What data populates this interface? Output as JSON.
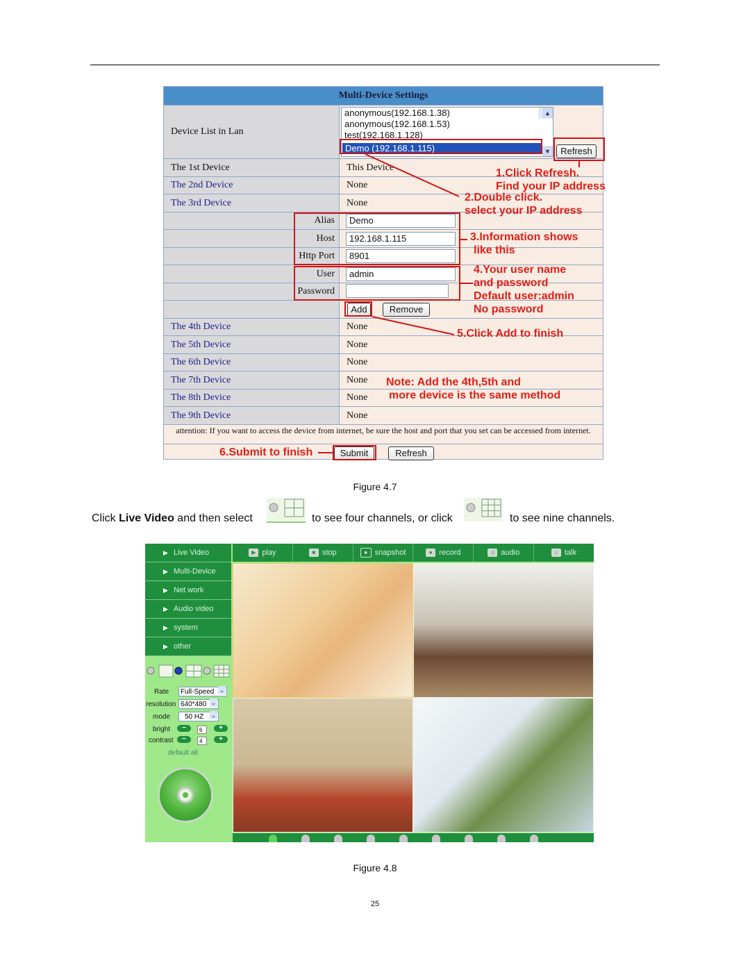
{
  "figure47": {
    "title": "Multi-Device Settings",
    "device_list_label": "Device List in Lan",
    "device_list": [
      "anonymous(192.168.1.38)",
      "anonymous(192.168.1.53)",
      "test(192.168.1.128)",
      "Demo (192.168.1.115)"
    ],
    "refresh_top": "Refresh",
    "rows": [
      {
        "label": "The 1st Device",
        "value": "This Device"
      },
      {
        "label": "The 2nd Device",
        "value": "None"
      },
      {
        "label": "The 3rd Device",
        "value": "None"
      }
    ],
    "form": {
      "alias_label": "Alias",
      "alias_value": "Demo",
      "host_label": "Host",
      "host_value": "192.168.1.115",
      "port_label": "Http Port",
      "port_value": "8901",
      "user_label": "User",
      "user_value": "admin",
      "password_label": "Password",
      "password_value": "",
      "add": "Add",
      "remove": "Remove"
    },
    "rows2": [
      {
        "label": "The 4th Device",
        "value": "None"
      },
      {
        "label": "The 5th Device",
        "value": "None"
      },
      {
        "label": "The 6th Device",
        "value": "None"
      },
      {
        "label": "The 7th Device",
        "value": "None"
      },
      {
        "label": "The 8th Device",
        "value": "None"
      },
      {
        "label": "The 9th Device",
        "value": "None"
      }
    ],
    "attention": "attention: If you want to access the device from internet, be sure the host and port that you set can be accessed from internet.",
    "submit": "Submit",
    "refresh_bottom": "Refresh",
    "annotations": {
      "a1_l1": "1.Click Refresh.",
      "a1_l2": "Find your IP address",
      "a2_l1": "2.Double click.",
      "a2_l2": "select your IP address",
      "a3_l1": "3.Information shows",
      "a3_l2": "like this",
      "a4_l1": "4.Your user name",
      "a4_l2": "and password",
      "a4_l3": "Default user:admin",
      "a4_l4": "No password",
      "a5": "5.Click Add to finish",
      "note_l1": "Note: Add the 4th,5th and",
      "note_l2": "more device is the same method",
      "a6": "6.Submit to finish"
    }
  },
  "caption47": "Figure 4.7",
  "instruction": {
    "p1": "Click ",
    "bold": "Live Video",
    "p2": " and then select",
    "p3": "to see four channels, or click",
    "p4": "to see nine channels."
  },
  "figure48": {
    "sidebar": [
      "Live Video",
      "Multi-Device",
      "Net work",
      "Audio video",
      "system",
      "other"
    ],
    "toolbar": [
      "play",
      "stop",
      "snapshot",
      "record",
      "audio",
      "talk"
    ],
    "controls": {
      "rate_label": "Rate",
      "rate_value": "Full-Speed",
      "resolution_label": "resolution",
      "resolution_value": "640*480",
      "mode_label": "mode",
      "mode_value": "50 HZ",
      "bright_label": "bright",
      "bright_value": "6",
      "contrast_label": "contrast",
      "contrast_value": "4",
      "default_all": "default all"
    },
    "channel_count": 9,
    "active_channel": 1
  },
  "caption48": "Figure 4.8",
  "page_number": "25",
  "colors": {
    "header_blue": "#4a8ec9",
    "annotation_red": "#e0201a",
    "ui_green": "#1f8f3e",
    "panel_green": "#9fe88a"
  }
}
